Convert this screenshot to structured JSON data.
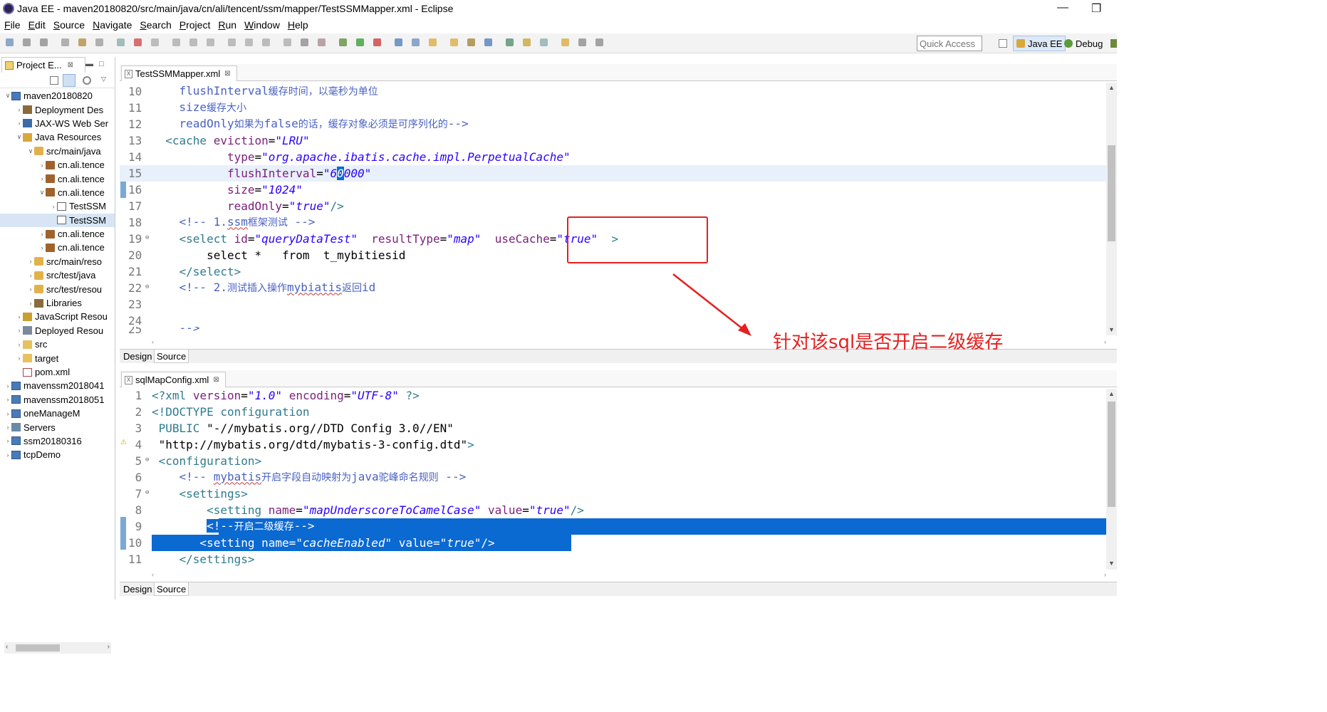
{
  "window": {
    "title": "Java EE - maven20180820/src/main/java/cn/ali/tencent/ssm/mapper/TestSSMMapper.xml - Eclipse",
    "minimize": "—",
    "maximize": "❐"
  },
  "menu": [
    "File",
    "Edit",
    "Source",
    "Navigate",
    "Search",
    "Project",
    "Run",
    "Window",
    "Help"
  ],
  "quick_access": {
    "placeholder": "Quick Access"
  },
  "perspectives": {
    "javaee": "Java EE",
    "debug": "Debug"
  },
  "project_explorer": {
    "tab_label": "Project E...",
    "tab_close": "⊠",
    "items": [
      {
        "indent": 0,
        "tw": "∨",
        "label": "maven20180820",
        "icon": "project"
      },
      {
        "indent": 1,
        "tw": "›",
        "label": "Deployment Des",
        "icon": "deploy"
      },
      {
        "indent": 1,
        "tw": "›",
        "label": "JAX-WS Web Ser",
        "icon": "ws"
      },
      {
        "indent": 1,
        "tw": "∨",
        "label": "Java Resources",
        "icon": "jres"
      },
      {
        "indent": 2,
        "tw": "∨",
        "label": "src/main/java",
        "icon": "srcfolder"
      },
      {
        "indent": 3,
        "tw": "›",
        "label": "cn.ali.tence",
        "icon": "package"
      },
      {
        "indent": 3,
        "tw": "›",
        "label": "cn.ali.tence",
        "icon": "package"
      },
      {
        "indent": 3,
        "tw": "∨",
        "label": "cn.ali.tence",
        "icon": "package"
      },
      {
        "indent": 4,
        "tw": "›",
        "label": "TestSSM",
        "icon": "javafile"
      },
      {
        "indent": 4,
        "tw": "",
        "label": "TestSSM",
        "icon": "xmlfile",
        "selected": true
      },
      {
        "indent": 3,
        "tw": "›",
        "label": "cn.ali.tence",
        "icon": "package"
      },
      {
        "indent": 3,
        "tw": "›",
        "label": "cn.ali.tence",
        "icon": "package"
      },
      {
        "indent": 2,
        "tw": "›",
        "label": "src/main/reso",
        "icon": "srcfolder"
      },
      {
        "indent": 2,
        "tw": "›",
        "label": "src/test/java",
        "icon": "srcfolder"
      },
      {
        "indent": 2,
        "tw": "›",
        "label": "src/test/resou",
        "icon": "srcfolder"
      },
      {
        "indent": 2,
        "tw": "›",
        "label": "Libraries",
        "icon": "lib"
      },
      {
        "indent": 1,
        "tw": "›",
        "label": "JavaScript Resou",
        "icon": "jsres"
      },
      {
        "indent": 1,
        "tw": "›",
        "label": "Deployed Resou",
        "icon": "deployed"
      },
      {
        "indent": 1,
        "tw": "›",
        "label": "src",
        "icon": "folder"
      },
      {
        "indent": 1,
        "tw": "›",
        "label": "target",
        "icon": "folder"
      },
      {
        "indent": 1,
        "tw": "",
        "label": "pom.xml",
        "icon": "pom"
      },
      {
        "indent": 0,
        "tw": "›",
        "label": "mavenssm2018041",
        "icon": "project"
      },
      {
        "indent": 0,
        "tw": "›",
        "label": "mavenssm2018051",
        "icon": "project"
      },
      {
        "indent": 0,
        "tw": "›",
        "label": "oneManageM",
        "icon": "project"
      },
      {
        "indent": 0,
        "tw": "›",
        "label": "Servers",
        "icon": "servers"
      },
      {
        "indent": 0,
        "tw": "›",
        "label": "ssm20180316",
        "icon": "project"
      },
      {
        "indent": 0,
        "tw": "›",
        "label": "tcpDemo",
        "icon": "project"
      }
    ]
  },
  "editor_top": {
    "tab_label": "TestSSMMapper.xml",
    "tab_close": "⊠",
    "design_tab": "Design",
    "source_tab": "Source"
  },
  "editor_bottom": {
    "tab_label": "sqlMapConfig.xml",
    "tab_close": "⊠",
    "design_tab": "Design",
    "source_tab": "Source"
  },
  "annotation": "针对该sql是否开启二级缓存",
  "colors": {
    "selection": "#0b69d2",
    "annotation": "#e52020",
    "tag": "#2f7b8f",
    "attr": "#7a1f7a",
    "value": "#2a00ff",
    "comment": "#4a62c2"
  }
}
